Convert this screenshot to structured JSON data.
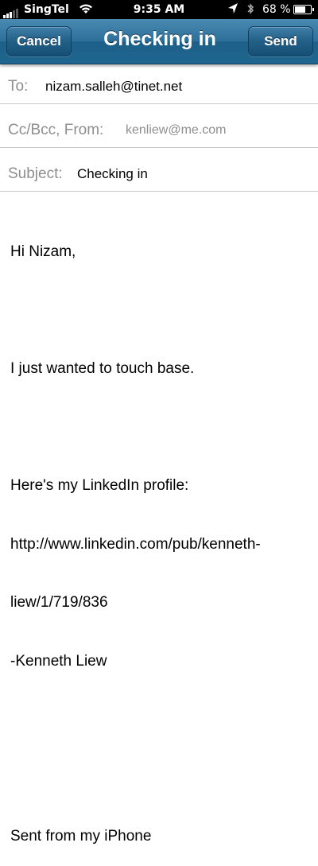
{
  "status_bar": {
    "carrier": "SingTel",
    "time": "9:35 AM",
    "battery_text": "68 %",
    "battery_level": 0.68,
    "icons": [
      "signal-bars-icon",
      "wifi-icon",
      "location-arrow-icon",
      "bluetooth-icon",
      "battery-icon"
    ]
  },
  "nav": {
    "cancel_label": "Cancel",
    "title": "Checking in",
    "send_label": "Send"
  },
  "fields": {
    "to_label": "To:",
    "to_value": "nizam.salleh@tinet.net",
    "cc_label": "Cc/Bcc, From:",
    "cc_value": "kenliew@me.com",
    "subject_label": "Subject:",
    "subject_value": "Checking in"
  },
  "body": {
    "lines": [
      "Hi Nizam,",
      "",
      "I just wanted to touch base.",
      "",
      "Here's my LinkedIn profile:",
      "http://www.linkedin.com/pub/kenneth-",
      "liew/1/719/836",
      "-Kenneth Liew",
      "",
      "",
      "Sent from my iPhone"
    ]
  },
  "colors": {
    "nav_bar": "#2c6f99",
    "label_gray": "#8e8e8e",
    "separator": "#c8c8c8"
  }
}
